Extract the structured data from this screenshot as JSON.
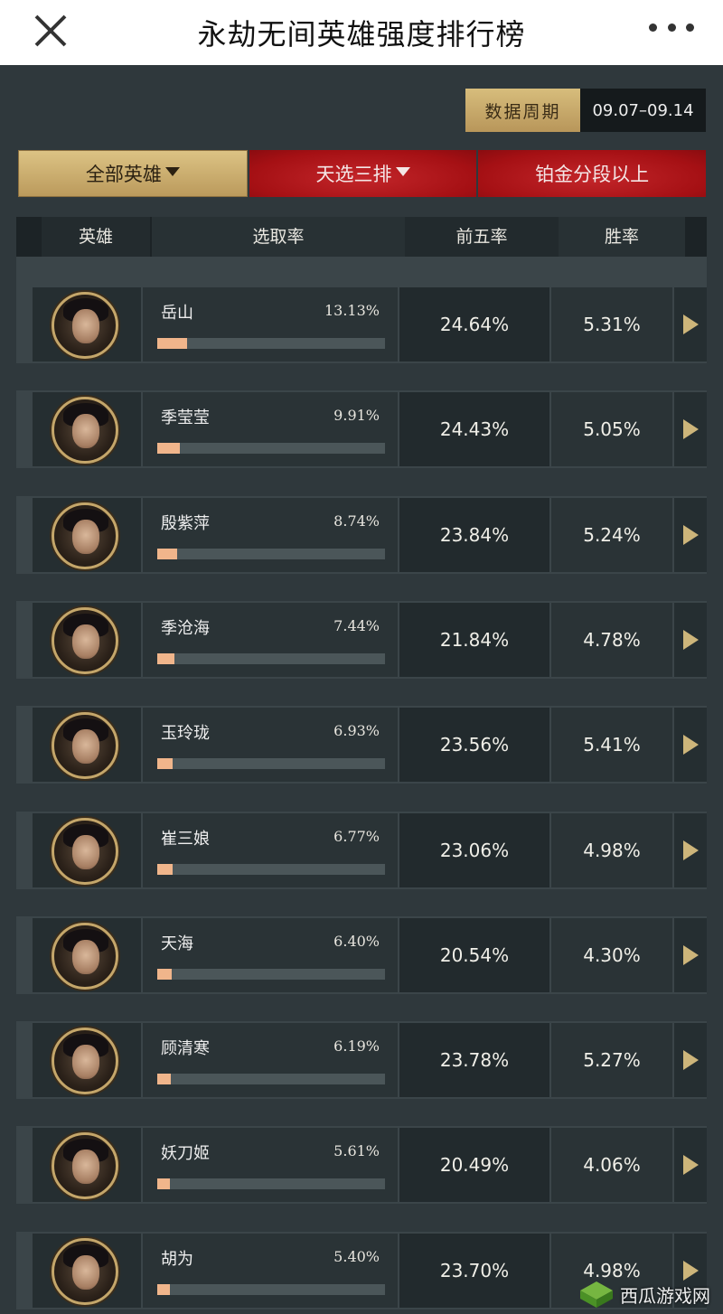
{
  "page": {
    "title": "永劫无间英雄强度排行榜"
  },
  "period": {
    "label": "数据周期",
    "value": "09.07–09.14"
  },
  "filters": [
    {
      "label": "全部英雄",
      "has_caret": true
    },
    {
      "label": "天选三排",
      "has_caret": true
    },
    {
      "label": "铂金分段以上",
      "has_caret": false
    }
  ],
  "table": {
    "headers": {
      "hero": "英雄",
      "pick": "选取率",
      "top5": "前五率",
      "win": "胜率"
    },
    "rows": [
      {
        "name": "岳山",
        "pick": "13.13%",
        "pick_value": 13.13,
        "top5": "24.64%",
        "win": "5.31%"
      },
      {
        "name": "季莹莹",
        "pick": "9.91%",
        "pick_value": 9.91,
        "top5": "24.43%",
        "win": "5.05%"
      },
      {
        "name": "殷紫萍",
        "pick": "8.74%",
        "pick_value": 8.74,
        "top5": "23.84%",
        "win": "5.24%"
      },
      {
        "name": "季沧海",
        "pick": "7.44%",
        "pick_value": 7.44,
        "top5": "21.84%",
        "win": "4.78%"
      },
      {
        "name": "玉玲珑",
        "pick": "6.93%",
        "pick_value": 6.93,
        "top5": "23.56%",
        "win": "5.41%"
      },
      {
        "name": "崔三娘",
        "pick": "6.77%",
        "pick_value": 6.77,
        "top5": "23.06%",
        "win": "4.98%"
      },
      {
        "name": "天海",
        "pick": "6.40%",
        "pick_value": 6.4,
        "top5": "20.54%",
        "win": "4.30%"
      },
      {
        "name": "顾清寒",
        "pick": "6.19%",
        "pick_value": 6.19,
        "top5": "23.78%",
        "win": "5.27%"
      },
      {
        "name": "妖刀姬",
        "pick": "5.61%",
        "pick_value": 5.61,
        "top5": "20.49%",
        "win": "4.06%"
      },
      {
        "name": "胡为",
        "pick": "5.40%",
        "pick_value": 5.4,
        "top5": "23.70%",
        "win": "4.98%"
      }
    ]
  },
  "watermark": {
    "text": "西瓜游戏网"
  },
  "colors": {
    "gold": "#c8a96a",
    "red": "#b01418",
    "bar_fill": "#f0b58b"
  },
  "icons": {
    "close": "close-icon",
    "more": "more-icon",
    "row_go": "play-arrow-icon"
  }
}
